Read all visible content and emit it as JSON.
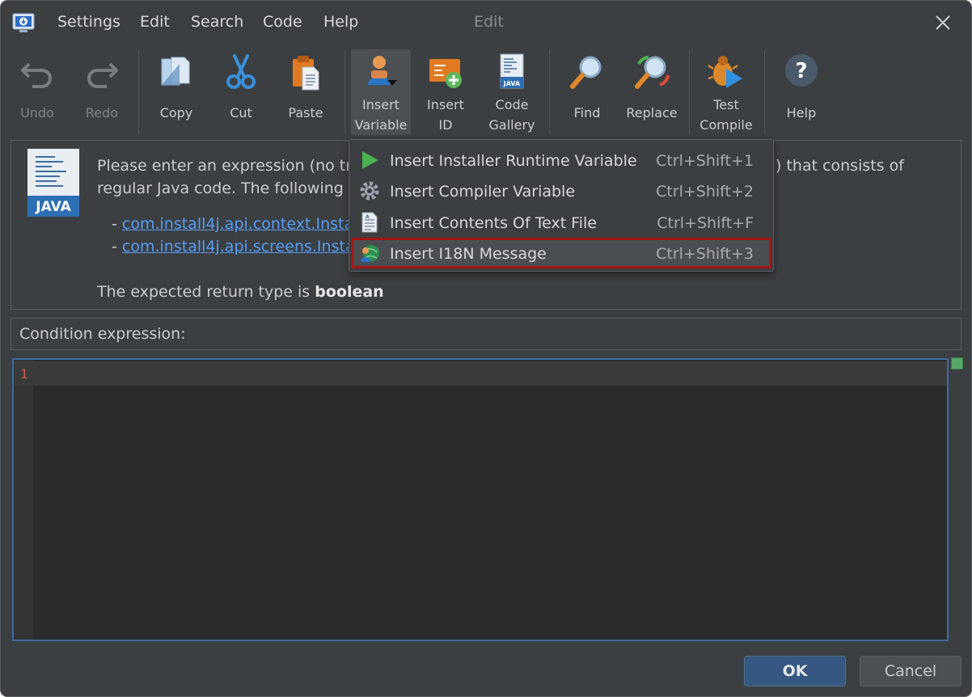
{
  "window": {
    "title": "Edit"
  },
  "menubar": {
    "items": [
      "Settings",
      "Edit",
      "Search",
      "Code",
      "Help"
    ]
  },
  "toolbar": {
    "buttons": [
      {
        "label1": "Undo",
        "label2": "",
        "icon": "undo-icon",
        "disabled": true
      },
      {
        "label1": "Redo",
        "label2": "",
        "icon": "redo-icon",
        "disabled": true
      },
      {
        "label1": "Copy",
        "label2": "",
        "icon": "copy-icon"
      },
      {
        "label1": "Cut",
        "label2": "",
        "icon": "scissors-icon"
      },
      {
        "label1": "Paste",
        "label2": "",
        "icon": "clipboard-icon"
      },
      {
        "label1": "Insert",
        "label2": "Variable",
        "icon": "insert-variable-icon",
        "active": true
      },
      {
        "label1": "Insert",
        "label2": "ID",
        "icon": "insert-id-icon"
      },
      {
        "label1": "Code",
        "label2": "Gallery",
        "icon": "java-file-icon"
      },
      {
        "label1": "Find",
        "label2": "",
        "icon": "magnifier-icon"
      },
      {
        "label1": "Replace",
        "label2": "",
        "icon": "replace-icon"
      },
      {
        "label1": "Test",
        "label2": "Compile",
        "icon": "bug-run-icon"
      },
      {
        "label1": "Help",
        "label2": "",
        "icon": "help-icon"
      }
    ]
  },
  "info": {
    "line1a": "Please enter an expression (no tra",
    "line1b": ") that consists of",
    "line2a": "regular Java code. The following p",
    "link1_prefix": "- ",
    "link1": "com.install4j.api.context.Instal",
    "link2_prefix": "- ",
    "link2": "com.install4j.api.screens.Instal",
    "return_prefix": "The expected return type is ",
    "return_type": "boolean",
    "icon_text": "JAVA"
  },
  "condition": {
    "label": "Condition expression:"
  },
  "editor": {
    "line_number": "1",
    "content": ""
  },
  "dropdown": {
    "items": [
      {
        "label": "Insert Installer Runtime Variable",
        "shortcut": "Ctrl+Shift+1",
        "icon": "play-icon"
      },
      {
        "label": "Insert Compiler Variable",
        "shortcut": "Ctrl+Shift+2",
        "icon": "gear-icon"
      },
      {
        "label": "Insert Contents Of Text File",
        "shortcut": "Ctrl+Shift+F",
        "icon": "text-file-icon"
      },
      {
        "label": "Insert I18N Message",
        "shortcut": "Ctrl+Shift+3",
        "icon": "i18n-globe-user-icon",
        "selected": true
      }
    ]
  },
  "footer": {
    "ok_label": "OK",
    "cancel_label": "Cancel"
  }
}
